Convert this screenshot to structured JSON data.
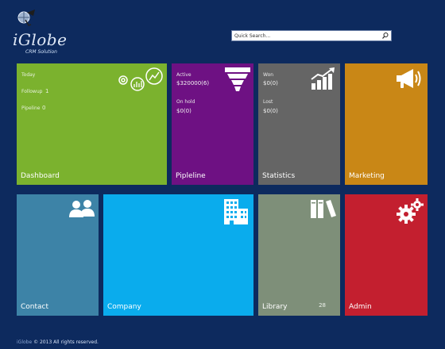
{
  "logo": {
    "brand": "iGlobe",
    "tagline": "CRM Solution"
  },
  "search": {
    "placeholder": "Quick Search..."
  },
  "tiles": {
    "dashboard": {
      "title": "Dashboard",
      "today_label": "Today",
      "followup_label": "Followup",
      "followup_count": "1",
      "pipeline_label": "Pipeline",
      "pipeline_count": "0"
    },
    "pipeline": {
      "title": "Pipleline",
      "active_label": "Active",
      "active_value": "$320000(6)",
      "onhold_label": "On hold",
      "onhold_value": "$0(0)"
    },
    "statistics": {
      "title": "Statistics",
      "won_label": "Won",
      "won_value": "$0(0)",
      "lost_label": "Lost",
      "lost_value": "$0(0)"
    },
    "marketing": {
      "title": "Marketing"
    },
    "contact": {
      "title": "Contact"
    },
    "company": {
      "title": "Company"
    },
    "library": {
      "title": "Library",
      "count": "28"
    },
    "admin": {
      "title": "Admin"
    }
  },
  "footer": {
    "brand": "iGlobe",
    "text": "© 2013 All rights reserved."
  },
  "colors": {
    "background": "#0d2a5e",
    "dashboard": "#7bb22e",
    "pipeline": "#6e1183",
    "statistics": "#656565",
    "marketing": "#c98716",
    "contact": "#3d83a7",
    "company": "#0aaced",
    "library": "#7e8f79",
    "admin": "#c31f2f"
  },
  "icons": [
    "globe-icon",
    "search-icon",
    "dashboard-icon",
    "funnel-icon",
    "bar-chart-icon",
    "megaphone-icon",
    "people-icon",
    "building-icon",
    "books-icon",
    "gears-icon"
  ]
}
